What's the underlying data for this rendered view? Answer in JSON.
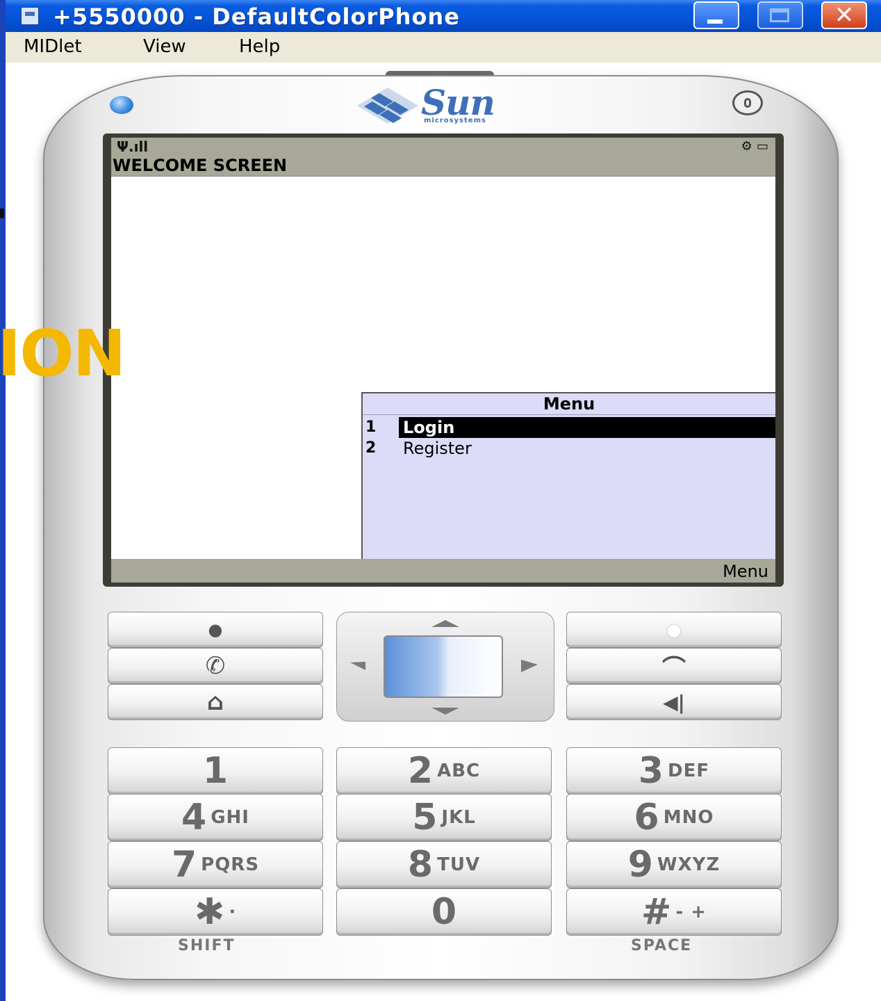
{
  "slide": {
    "visible_text": "ION"
  },
  "window": {
    "title": "+5550000 - DefaultColorPhone",
    "close_glyph": "✕",
    "menus": [
      "MIDlet",
      "View",
      "Help"
    ]
  },
  "phone": {
    "brand": "Sun",
    "brand_sub": "microsystems",
    "screen": {
      "signal": "Ψ.ıll",
      "status_icons": "⚙ ▭",
      "title": "WELCOME SCREEN",
      "softkey_right": "Menu",
      "popup": {
        "title": "Menu",
        "items": [
          {
            "num": "1",
            "label": "Login",
            "selected": true
          },
          {
            "num": "2",
            "label": "Register",
            "selected": false
          }
        ]
      }
    },
    "keys": {
      "soft_left": "●",
      "soft_right": "●",
      "call": "✆",
      "home": "⌂",
      "end": "⌒",
      "clear": "◀|",
      "numpad": [
        {
          "main": "1",
          "sub": ""
        },
        {
          "main": "2",
          "sub": "ABC"
        },
        {
          "main": "3",
          "sub": "DEF"
        },
        {
          "main": "4",
          "sub": "GHI"
        },
        {
          "main": "5",
          "sub": "JKL"
        },
        {
          "main": "6",
          "sub": "MNO"
        },
        {
          "main": "7",
          "sub": "PQRS"
        },
        {
          "main": "8",
          "sub": "TUV"
        },
        {
          "main": "9",
          "sub": "WXYZ"
        },
        {
          "main": "✱",
          "sub": "·"
        },
        {
          "main": "0",
          "sub": ""
        },
        {
          "main": "#",
          "sub": "- +"
        }
      ],
      "shift_label": "SHIFT",
      "space_label": "SPACE"
    }
  },
  "colors": {
    "titlebar": "#0553d6",
    "slide_accent": "#f5b800",
    "popup_bg": "#dcdcf8",
    "status_bar": "#a8a898"
  }
}
